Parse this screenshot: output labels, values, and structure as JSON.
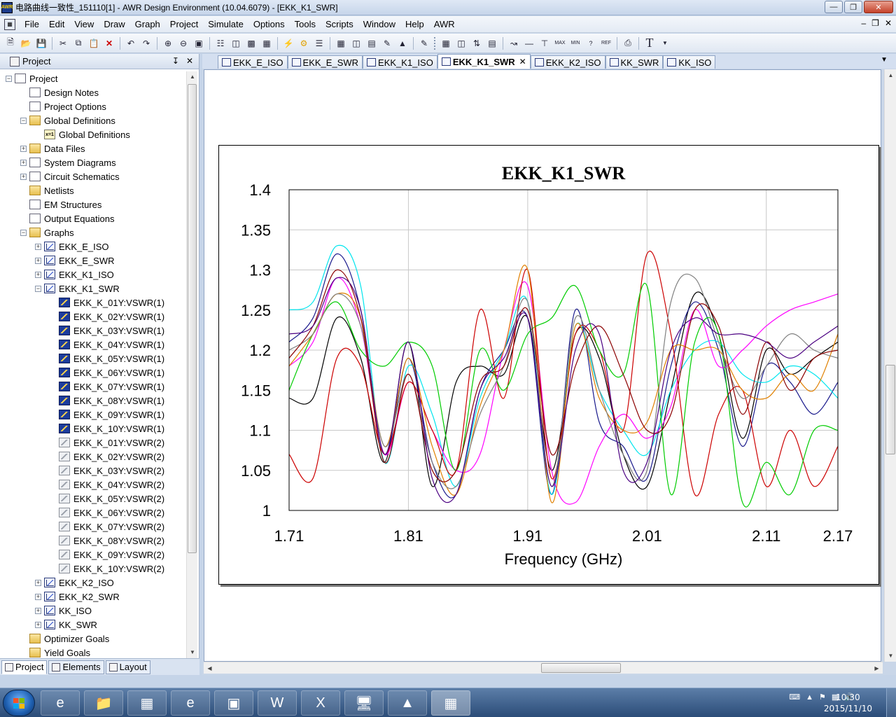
{
  "window": {
    "title": "电路曲线一致性_151110[1] - AWR Design Environment (10.04.6079) - [EKK_K1_SWR]",
    "app_icon_label": "AWR"
  },
  "menu": {
    "items": [
      "File",
      "Edit",
      "View",
      "Draw",
      "Graph",
      "Project",
      "Simulate",
      "Options",
      "Tools",
      "Scripts",
      "Window",
      "Help",
      "AWR"
    ]
  },
  "project_pane": {
    "title": "Project",
    "tree": [
      {
        "label": "Project",
        "level": 0,
        "expander": "−",
        "icon": "project"
      },
      {
        "label": "Design Notes",
        "level": 1,
        "expander": "",
        "icon": "doc"
      },
      {
        "label": "Project Options",
        "level": 1,
        "expander": "",
        "icon": "doc"
      },
      {
        "label": "Global Definitions",
        "level": 1,
        "expander": "−",
        "icon": "folder"
      },
      {
        "label": "Global Definitions",
        "level": 2,
        "expander": "",
        "icon": "x"
      },
      {
        "label": "Data Files",
        "level": 1,
        "expander": "+",
        "icon": "folder"
      },
      {
        "label": "System Diagrams",
        "level": 1,
        "expander": "+",
        "icon": "doc"
      },
      {
        "label": "Circuit Schematics",
        "level": 1,
        "expander": "+",
        "icon": "doc"
      },
      {
        "label": "Netlists",
        "level": 1,
        "expander": "",
        "icon": "folder"
      },
      {
        "label": "EM Structures",
        "level": 1,
        "expander": "",
        "icon": "doc"
      },
      {
        "label": "Output Equations",
        "level": 1,
        "expander": "",
        "icon": "doc"
      },
      {
        "label": "Graphs",
        "level": 1,
        "expander": "−",
        "icon": "folder"
      },
      {
        "label": "EKK_E_ISO",
        "level": 2,
        "expander": "+",
        "icon": "graph"
      },
      {
        "label": "EKK_E_SWR",
        "level": 2,
        "expander": "+",
        "icon": "graph"
      },
      {
        "label": "EKK_K1_ISO",
        "level": 2,
        "expander": "+",
        "icon": "graph"
      },
      {
        "label": "EKK_K1_SWR",
        "level": 2,
        "expander": "−",
        "icon": "graph"
      },
      {
        "label": "EKK_K_01Y:VSWR(1)",
        "level": 3,
        "expander": "",
        "icon": "meas"
      },
      {
        "label": "EKK_K_02Y:VSWR(1)",
        "level": 3,
        "expander": "",
        "icon": "meas"
      },
      {
        "label": "EKK_K_03Y:VSWR(1)",
        "level": 3,
        "expander": "",
        "icon": "meas"
      },
      {
        "label": "EKK_K_04Y:VSWR(1)",
        "level": 3,
        "expander": "",
        "icon": "meas"
      },
      {
        "label": "EKK_K_05Y:VSWR(1)",
        "level": 3,
        "expander": "",
        "icon": "meas"
      },
      {
        "label": "EKK_K_06Y:VSWR(1)",
        "level": 3,
        "expander": "",
        "icon": "meas"
      },
      {
        "label": "EKK_K_07Y:VSWR(1)",
        "level": 3,
        "expander": "",
        "icon": "meas"
      },
      {
        "label": "EKK_K_08Y:VSWR(1)",
        "level": 3,
        "expander": "",
        "icon": "meas"
      },
      {
        "label": "EKK_K_09Y:VSWR(1)",
        "level": 3,
        "expander": "",
        "icon": "meas"
      },
      {
        "label": "EKK_K_10Y:VSWR(1)",
        "level": 3,
        "expander": "",
        "icon": "meas"
      },
      {
        "label": "EKK_K_01Y:VSWR(2)",
        "level": 3,
        "expander": "",
        "icon": "meas-off"
      },
      {
        "label": "EKK_K_02Y:VSWR(2)",
        "level": 3,
        "expander": "",
        "icon": "meas-off"
      },
      {
        "label": "EKK_K_03Y:VSWR(2)",
        "level": 3,
        "expander": "",
        "icon": "meas-off"
      },
      {
        "label": "EKK_K_04Y:VSWR(2)",
        "level": 3,
        "expander": "",
        "icon": "meas-off"
      },
      {
        "label": "EKK_K_05Y:VSWR(2)",
        "level": 3,
        "expander": "",
        "icon": "meas-off"
      },
      {
        "label": "EKK_K_06Y:VSWR(2)",
        "level": 3,
        "expander": "",
        "icon": "meas-off"
      },
      {
        "label": "EKK_K_07Y:VSWR(2)",
        "level": 3,
        "expander": "",
        "icon": "meas-off"
      },
      {
        "label": "EKK_K_08Y:VSWR(2)",
        "level": 3,
        "expander": "",
        "icon": "meas-off"
      },
      {
        "label": "EKK_K_09Y:VSWR(2)",
        "level": 3,
        "expander": "",
        "icon": "meas-off"
      },
      {
        "label": "EKK_K_10Y:VSWR(2)",
        "level": 3,
        "expander": "",
        "icon": "meas-off"
      },
      {
        "label": "EKK_K2_ISO",
        "level": 2,
        "expander": "+",
        "icon": "graph"
      },
      {
        "label": "EKK_K2_SWR",
        "level": 2,
        "expander": "+",
        "icon": "graph"
      },
      {
        "label": "KK_ISO",
        "level": 2,
        "expander": "+",
        "icon": "graph"
      },
      {
        "label": "KK_SWR",
        "level": 2,
        "expander": "+",
        "icon": "graph"
      },
      {
        "label": "Optimizer Goals",
        "level": 1,
        "expander": "",
        "icon": "folder"
      },
      {
        "label": "Yield Goals",
        "level": 1,
        "expander": "",
        "icon": "folder"
      }
    ],
    "bottom_tabs": [
      "Project",
      "Elements",
      "Layout"
    ]
  },
  "doc_tabs": [
    {
      "label": "EKK_E_ISO",
      "active": false
    },
    {
      "label": "EKK_E_SWR",
      "active": false
    },
    {
      "label": "EKK_K1_ISO",
      "active": false
    },
    {
      "label": "EKK_K1_SWR",
      "active": true
    },
    {
      "label": "EKK_K2_ISO",
      "active": false
    },
    {
      "label": "KK_SWR",
      "active": false
    },
    {
      "label": "KK_ISO",
      "active": false
    }
  ],
  "chart_data": {
    "type": "line",
    "title": "EKK_K1_SWR",
    "xlabel": "Frequency (GHz)",
    "ylabel": "",
    "xlim": [
      1.71,
      2.17
    ],
    "ylim": [
      1.0,
      1.4
    ],
    "x_ticks": [
      "1.71",
      "1.81",
      "1.91",
      "2.01",
      "2.11",
      "2.17"
    ],
    "y_ticks": [
      "1.4",
      "1.35",
      "1.3",
      "1.25",
      "1.2",
      "1.15",
      "1.1",
      "1.05",
      "1"
    ],
    "grid": true,
    "x": [
      1.71,
      1.73,
      1.75,
      1.77,
      1.79,
      1.81,
      1.83,
      1.85,
      1.87,
      1.89,
      1.91,
      1.93,
      1.95,
      1.97,
      1.99,
      2.01,
      2.03,
      2.05,
      2.07,
      2.09,
      2.11,
      2.13,
      2.15,
      2.17
    ],
    "series": [
      {
        "color": "#000000",
        "values": [
          1.14,
          1.14,
          1.24,
          1.19,
          1.06,
          1.21,
          1.03,
          1.16,
          1.18,
          1.17,
          1.24,
          1.05,
          1.22,
          1.19,
          1.07,
          1.03,
          1.15,
          1.27,
          1.22,
          1.09,
          1.2,
          1.17,
          1.19,
          1.21
        ]
      },
      {
        "color": "#1a1a8c",
        "values": [
          1.21,
          1.24,
          1.32,
          1.25,
          1.07,
          1.19,
          1.06,
          1.02,
          1.15,
          1.2,
          1.24,
          1.02,
          1.25,
          1.11,
          1.08,
          1.04,
          1.18,
          1.26,
          1.2,
          1.08,
          1.18,
          1.16,
          1.12,
          1.16
        ]
      },
      {
        "color": "#00e5ee",
        "values": [
          1.25,
          1.26,
          1.33,
          1.28,
          1.06,
          1.18,
          1.12,
          1.03,
          1.14,
          1.2,
          1.26,
          1.02,
          1.23,
          1.15,
          1.1,
          1.07,
          1.15,
          1.2,
          1.21,
          1.17,
          1.16,
          1.18,
          1.17,
          1.14
        ]
      },
      {
        "color": "#ff00ff",
        "values": [
          1.18,
          1.21,
          1.29,
          1.23,
          1.07,
          1.16,
          1.1,
          1.05,
          1.07,
          1.2,
          1.28,
          1.05,
          1.01,
          1.08,
          1.12,
          1.09,
          1.13,
          1.25,
          1.18,
          1.2,
          1.23,
          1.25,
          1.26,
          1.27
        ]
      },
      {
        "color": "#cc0000",
        "values": [
          1.07,
          1.04,
          1.19,
          1.18,
          1.07,
          1.16,
          1.1,
          1.05,
          1.25,
          1.14,
          1.3,
          1.04,
          1.22,
          1.2,
          1.1,
          1.32,
          1.22,
          1.02,
          1.12,
          1.15,
          1.03,
          1.1,
          1.03,
          1.08
        ]
      },
      {
        "color": "#00cc00",
        "values": [
          1.15,
          1.22,
          1.26,
          1.2,
          1.18,
          1.21,
          1.18,
          1.05,
          1.2,
          1.15,
          1.22,
          1.24,
          1.28,
          1.2,
          1.17,
          1.28,
          1.02,
          1.21,
          1.22,
          1.01,
          1.06,
          1.02,
          1.1,
          1.1
        ]
      },
      {
        "color": "#e08000",
        "values": [
          1.18,
          1.22,
          1.27,
          1.24,
          1.08,
          1.19,
          1.08,
          1.02,
          1.13,
          1.2,
          1.3,
          1.01,
          1.23,
          1.14,
          1.1,
          1.11,
          1.2,
          1.2,
          1.2,
          1.15,
          1.14,
          1.17,
          1.15,
          1.22
        ]
      },
      {
        "color": "#808080",
        "values": [
          1.2,
          1.22,
          1.27,
          1.23,
          1.08,
          1.17,
          1.06,
          1.03,
          1.12,
          1.18,
          1.26,
          1.03,
          1.24,
          1.15,
          1.07,
          1.05,
          1.26,
          1.29,
          1.21,
          1.14,
          1.18,
          1.22,
          1.2,
          1.19
        ]
      },
      {
        "color": "#8b0000",
        "values": [
          1.19,
          1.23,
          1.3,
          1.24,
          1.06,
          1.17,
          1.05,
          1.05,
          1.16,
          1.18,
          1.25,
          1.07,
          1.18,
          1.23,
          1.17,
          1.1,
          1.12,
          1.25,
          1.23,
          1.12,
          1.21,
          1.15,
          1.19,
          1.2
        ]
      },
      {
        "color": "#4b0082",
        "values": [
          1.22,
          1.23,
          1.29,
          1.25,
          1.07,
          1.21,
          1.04,
          1.02,
          1.15,
          1.19,
          1.24,
          1.03,
          1.2,
          1.22,
          1.05,
          1.06,
          1.2,
          1.24,
          1.22,
          1.22,
          1.21,
          1.19,
          1.21,
          1.23
        ]
      }
    ]
  },
  "taskbar": {
    "clock_time": "10:30",
    "clock_date": "2015/11/10"
  }
}
